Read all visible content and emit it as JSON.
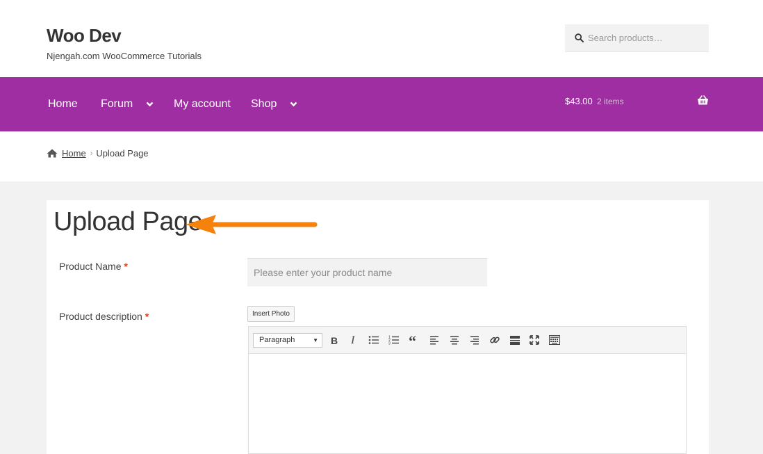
{
  "site": {
    "title": "Woo Dev",
    "description": "Njengah.com WooCommerce Tutorials"
  },
  "search": {
    "placeholder": "Search products…",
    "icon": "search-icon"
  },
  "nav": {
    "items": [
      {
        "label": "Home",
        "has_dropdown": false
      },
      {
        "label": "Forum",
        "has_dropdown": true
      },
      {
        "label": "My account",
        "has_dropdown": false
      },
      {
        "label": "Shop",
        "has_dropdown": true
      }
    ],
    "cart_total": "$43.00",
    "cart_count": "2 items",
    "cart_icon": "basket-icon"
  },
  "breadcrumb": {
    "home": "Home",
    "current": "Upload Page",
    "separator": "›"
  },
  "page": {
    "title": "Upload Page"
  },
  "form": {
    "product_name_label": "Product Name",
    "product_name_placeholder": "Please enter your product name",
    "product_description_label": "Product description",
    "required_marker": "*",
    "insert_photo_label": "Insert Photo",
    "format_select_value": "Paragraph"
  },
  "colors": {
    "brand_purple": "#a02ea3",
    "accent_arrow": "#f5820d",
    "required": "#e2401c"
  }
}
